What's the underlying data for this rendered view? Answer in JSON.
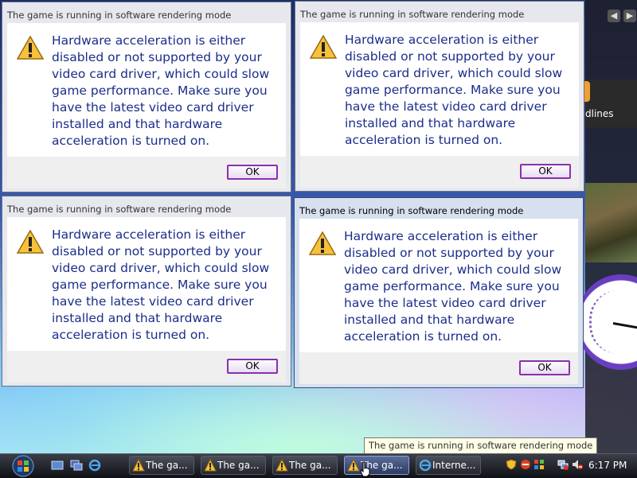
{
  "dialog": {
    "title": "The game is running in software rendering mode",
    "message": "Hardware acceleration is either disabled or not supported by your video card driver, which could slow game performance. Make sure you have the latest video card driver installed and that hardware acceleration is turned on.",
    "ok_label": "OK",
    "icon": "warning-icon"
  },
  "sidebar": {
    "prev": "◀",
    "next": "▶",
    "feed_label": "dlines"
  },
  "tooltip": "The game is running in software rendering mode",
  "taskbar": {
    "buttons": [
      {
        "label": "The ga...",
        "icon": "warning-icon"
      },
      {
        "label": "The ga...",
        "icon": "warning-icon"
      },
      {
        "label": "The ga...",
        "icon": "warning-icon"
      },
      {
        "label": "The ga...",
        "icon": "warning-icon"
      },
      {
        "label": "Interne...",
        "icon": "ie-icon"
      }
    ],
    "clock": "6:17 PM"
  },
  "colors": {
    "message_text": "#1b2e8a",
    "ok_border": "#8a2fb0",
    "taskbar_active": "#2c3a62"
  }
}
